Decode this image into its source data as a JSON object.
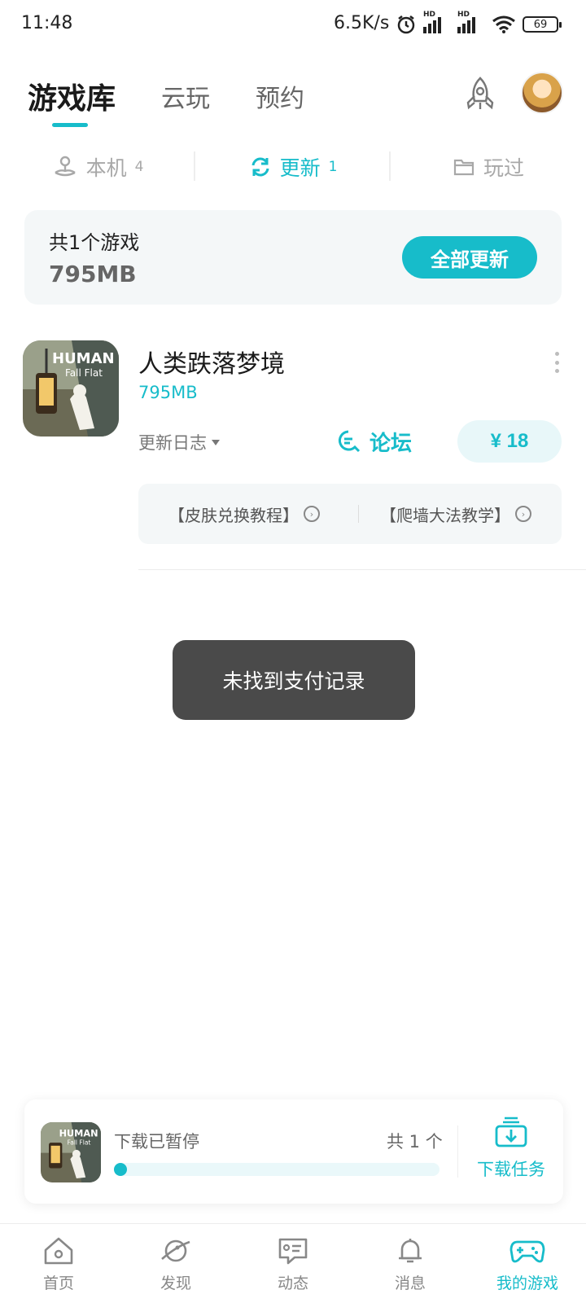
{
  "status_bar": {
    "time": "11:48",
    "net_speed": "6.5K/s",
    "battery": "69",
    "signal_badge": "HD"
  },
  "header": {
    "tabs": [
      {
        "label": "游戏库",
        "active": true
      },
      {
        "label": "云玩",
        "active": false
      },
      {
        "label": "预约",
        "active": false
      }
    ],
    "rocket_icon": "rocket-icon",
    "avatar": "avatar"
  },
  "subtabs": [
    {
      "label": "本机",
      "count": "4",
      "icon": "local-device-icon",
      "active": false
    },
    {
      "label": "更新",
      "count": "1",
      "icon": "refresh-icon",
      "active": true
    },
    {
      "label": "玩过",
      "count": "",
      "icon": "folder-icon",
      "active": false
    }
  ],
  "summary": {
    "count_text": "共1个游戏",
    "size_text": "795MB",
    "update_all_label": "全部更新"
  },
  "game": {
    "name": "人类跌落梦境",
    "size": "795MB",
    "icon_text_line1": "HUMAN",
    "icon_text_line2": "Fall Flat",
    "changelog_label": "更新日志",
    "forum_label": "论坛",
    "price_label": "¥ 18",
    "links": [
      {
        "label": "【皮肤兑换教程】"
      },
      {
        "label": "【爬墙大法教学】"
      }
    ]
  },
  "toast": {
    "message": "未找到支付记录"
  },
  "download_panel": {
    "status": "下载已暂停",
    "total": "共 1 个",
    "task_label": "下载任务",
    "progress_percent": 0
  },
  "bottom_nav": [
    {
      "label": "首页",
      "icon": "home-icon",
      "active": false
    },
    {
      "label": "发现",
      "icon": "planet-icon",
      "active": false
    },
    {
      "label": "动态",
      "icon": "chat-card-icon",
      "active": false
    },
    {
      "label": "消息",
      "icon": "bell-icon",
      "active": false
    },
    {
      "label": "我的游戏",
      "icon": "gamepad-icon",
      "active": true
    }
  ],
  "colors": {
    "accent": "#17bcca",
    "toast_bg": "#4a4a4a",
    "card_bg": "#f4f7f8"
  }
}
